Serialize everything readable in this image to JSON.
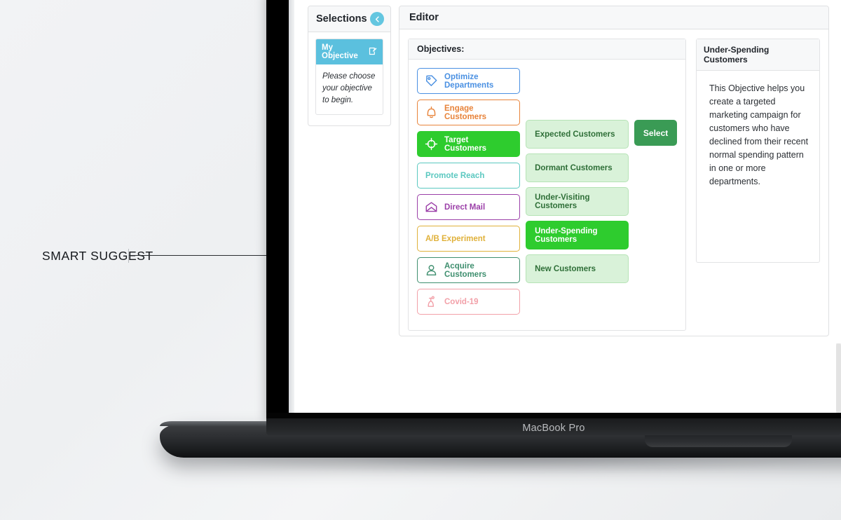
{
  "annotation": {
    "label": "SMART SUGGEST"
  },
  "device": {
    "model_label": "MacBook Pro"
  },
  "selections": {
    "title": "Selections",
    "collapse_icon": "chevron-left-icon",
    "card": {
      "title": "My Objective",
      "edit_icon": "edit-square-icon",
      "body": "Please choose your objective to begin."
    }
  },
  "editor": {
    "title": "Editor",
    "objectives": {
      "title": "Objectives:",
      "primary": [
        {
          "label": "Optimize Departments",
          "icon": "price-tag-icon",
          "color": "#4a90e2",
          "selected": false
        },
        {
          "label": "Engage Customers",
          "icon": "bell-icon",
          "color": "#e8833a",
          "selected": false
        },
        {
          "label": "Target Customers",
          "icon": "crosshair-icon",
          "color": "#2ecc2e",
          "selected": true
        },
        {
          "label": "Promote Reach",
          "icon": "none",
          "color": "#5bc8c0",
          "selected": false
        },
        {
          "label": "Direct Mail",
          "icon": "open-envelope-icon",
          "color": "#9b3fa8",
          "selected": false
        },
        {
          "label": "A/B Experiment",
          "icon": "none",
          "color": "#e0b13a",
          "selected": false
        },
        {
          "label": "Acquire Customers",
          "icon": "user-icon",
          "color": "#3f8f6f",
          "selected": false
        },
        {
          "label": "Covid-19",
          "icon": "virus-person-icon",
          "color": "#f2a0a8",
          "selected": false
        }
      ],
      "secondary": [
        {
          "label": "Expected Customers",
          "selected": false
        },
        {
          "label": "Dormant Customers",
          "selected": false
        },
        {
          "label": "Under-Visiting Customers",
          "selected": false
        },
        {
          "label": "Under-Spending Customers",
          "selected": true
        },
        {
          "label": "New Customers",
          "selected": false
        }
      ],
      "select_button": "Select"
    },
    "info": {
      "title": "Under-Spending Customers",
      "body": "This Objective helps you create a targeted marketing campaign for customers who have declined from their recent normal spending pattern in one or more departments."
    }
  },
  "colors": {
    "accent_blue": "#5bc0de",
    "selected_green": "#2ecc2e",
    "select_button_green": "#3a9b55",
    "pale_green": "#d9f2d9"
  }
}
